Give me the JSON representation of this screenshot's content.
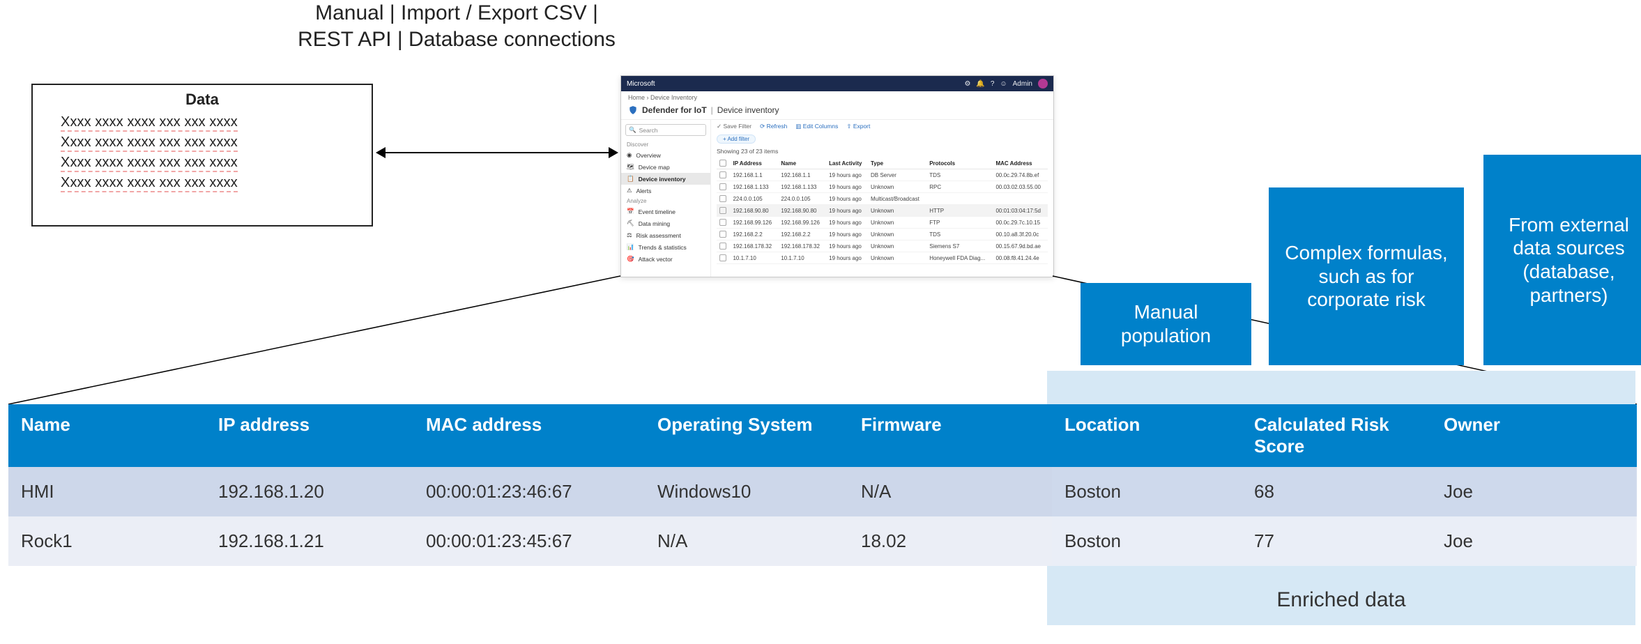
{
  "top_annotation": {
    "line1": "Manual | Import / Export CSV |",
    "line2": "REST API | Database connections"
  },
  "data_box": {
    "title": "Data",
    "lines": [
      "Xxxx xxxx xxxx xxx xxx xxxx",
      "Xxxx xxxx xxxx xxx xxx xxxx",
      "Xxxx xxxx xxxx xxx xxx xxxx",
      "Xxxx xxxx xxxx xxx xxx xxxx"
    ]
  },
  "app": {
    "brand": "Microsoft",
    "user": "Admin",
    "breadcrumb": "Home  ›  Device Inventory",
    "product": "Defender for IoT",
    "page": "Device inventory",
    "search_placeholder": "Search",
    "sidebar": {
      "sections": {
        "discover": "Discover",
        "analyze": "Analyze"
      },
      "discover_items": [
        {
          "label": "Overview"
        },
        {
          "label": "Device map"
        },
        {
          "label": "Device inventory",
          "selected": true
        },
        {
          "label": "Alerts"
        }
      ],
      "analyze_items": [
        {
          "label": "Event timeline"
        },
        {
          "label": "Data mining"
        },
        {
          "label": "Risk assessment"
        },
        {
          "label": "Trends & statistics"
        },
        {
          "label": "Attack vector"
        }
      ]
    },
    "toolbar": {
      "save_filter": "Save Filter",
      "refresh": "Refresh",
      "edit_columns": "Edit Columns",
      "export": "Export",
      "add_filter": "+ Add filter"
    },
    "count_text": "Showing 23 of 23 items",
    "table": {
      "columns": [
        "IP Address",
        "Name",
        "Last Activity",
        "Type",
        "Protocols",
        "MAC Address"
      ],
      "rows": [
        {
          "ip": "192.168.1.1",
          "name": "192.168.1.1",
          "last": "19 hours ago",
          "type": "DB Server",
          "protocols": "TDS",
          "mac": "00.0c.29.74.8b.ef"
        },
        {
          "ip": "192.168.1.133",
          "name": "192.168.1.133",
          "last": "19 hours ago",
          "type": "Unknown",
          "protocols": "RPC",
          "mac": "00.03.02.03.55.00"
        },
        {
          "ip": "224.0.0.105",
          "name": "224.0.0.105",
          "last": "19 hours ago",
          "type": "Multicast/Broadcast",
          "protocols": "",
          "mac": ""
        },
        {
          "ip": "192.168.90.80",
          "name": "192.168.90.80",
          "last": "19 hours ago",
          "type": "Unknown",
          "protocols": "HTTP",
          "mac": "00:01:03:04:17:5d",
          "selected": true
        },
        {
          "ip": "192.168.99.126",
          "name": "192.168.99.126",
          "last": "19 hours ago",
          "type": "Unknown",
          "protocols": "FTP",
          "mac": "00.0c.29.7c.10.15"
        },
        {
          "ip": "192.168.2.2",
          "name": "192.168.2.2",
          "last": "19 hours ago",
          "type": "Unknown",
          "protocols": "TDS",
          "mac": "00.10.a8.3f.20.0c"
        },
        {
          "ip": "192.168.178.32",
          "name": "192.168.178.32",
          "last": "19 hours ago",
          "type": "Unknown",
          "protocols": "Siemens S7",
          "mac": "00.15.67.9d.bd.ae"
        },
        {
          "ip": "10.1.7.10",
          "name": "10.1.7.10",
          "last": "19 hours ago",
          "type": "Unknown",
          "protocols": "Honeywell FDA Diag...",
          "mac": "00.08.f8.41.24.4e"
        }
      ]
    }
  },
  "callouts": {
    "manual": "Manual population",
    "formulas": "Complex formulas, such as for corporate risk",
    "external": "From external data sources (database, partners)"
  },
  "enriched_caption": "Enriched data",
  "main_table": {
    "columns": [
      {
        "key": "name",
        "label": "Name",
        "enriched": false
      },
      {
        "key": "ip",
        "label": "IP address",
        "enriched": false
      },
      {
        "key": "mac",
        "label": "MAC address",
        "enriched": false
      },
      {
        "key": "os",
        "label": "Operating System",
        "enriched": false
      },
      {
        "key": "fw",
        "label": "Firmware",
        "enriched": false
      },
      {
        "key": "loc",
        "label": "Location",
        "enriched": true
      },
      {
        "key": "risk",
        "label": "Calculated Risk Score",
        "enriched": true
      },
      {
        "key": "owner",
        "label": "Owner",
        "enriched": true
      }
    ],
    "rows": [
      {
        "name": "HMI",
        "ip": "192.168.1.20",
        "mac": "00:00:01:23:46:67",
        "os": "Windows10",
        "fw": "N/A",
        "loc": "Boston",
        "risk": "68",
        "owner": "Joe"
      },
      {
        "name": "Rock1",
        "ip": "192.168.1.21",
        "mac": "00:00:01:23:45:67",
        "os": "N/A",
        "fw": "18.02",
        "loc": "Boston",
        "risk": "77",
        "owner": "Joe"
      }
    ]
  }
}
